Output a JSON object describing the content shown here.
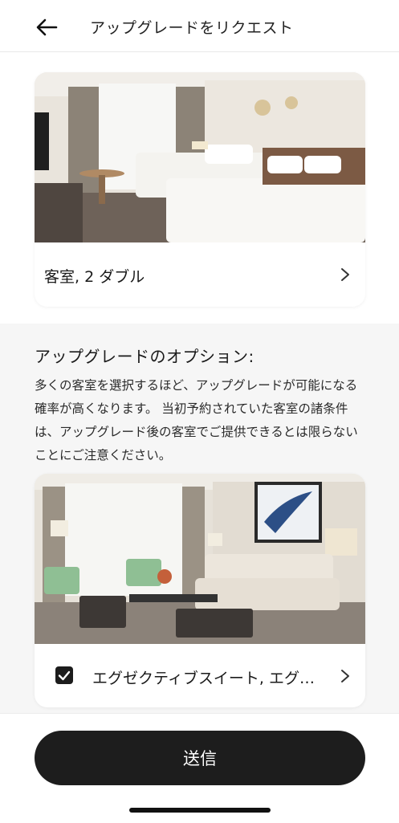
{
  "header": {
    "title": "アップグレードをリクエスト",
    "back_icon": "arrow-left-icon"
  },
  "current_room": {
    "name": "客室, 2 ダブル",
    "image": "twin-bed-hotel-room-photo"
  },
  "options": {
    "title": "アップグレードのオプション:",
    "description": "多くの客室を選択するほど、アップグレードが可能になる確率が高くなります。 当初予約されていた客室の諸条件は、アップグレード後の客室でご提供できるとは限らないことにご注意ください。",
    "items": [
      {
        "name": "エグゼクティブスイート, エグゼクティブラウンジアクセス",
        "checked": true,
        "image": "suite-living-room-photo"
      }
    ]
  },
  "submit": {
    "label": "送信"
  },
  "colors": {
    "primary": "#1d1d1d",
    "background": "#f6f6f6",
    "card": "#ffffff"
  }
}
